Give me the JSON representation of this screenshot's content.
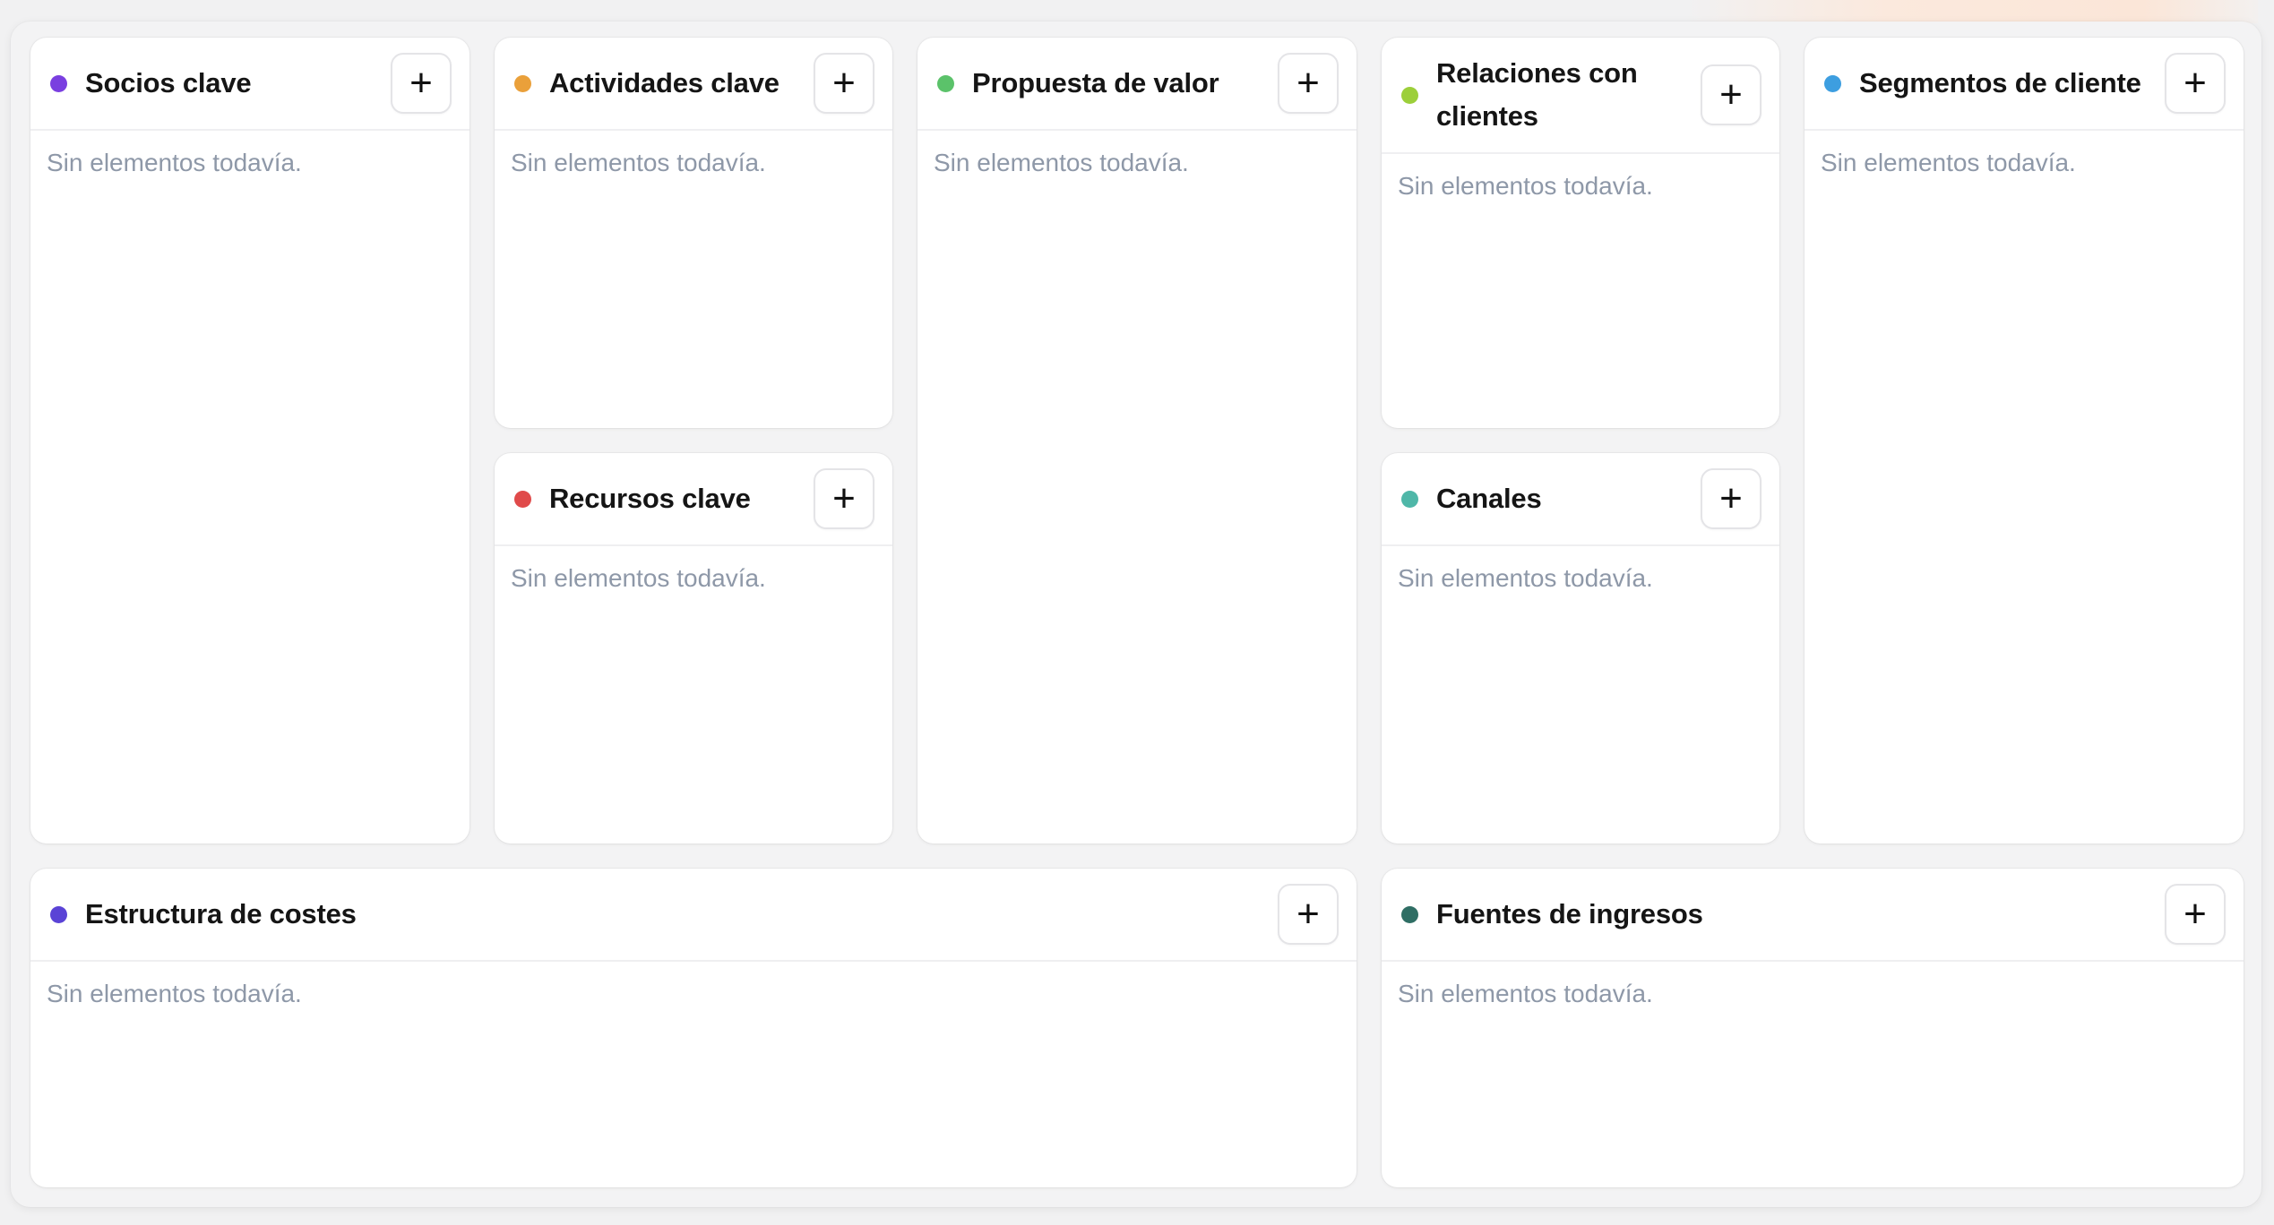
{
  "canvas": {
    "blocks": {
      "socios_clave": {
        "title": "Socios clave",
        "add_label": "+",
        "empty": "Sin elementos todavía.",
        "color": "#7a3fe0"
      },
      "actividades_clave": {
        "title": "Actividades clave",
        "add_label": "+",
        "empty": "Sin elementos todavía.",
        "color": "#eaa03a"
      },
      "recursos_clave": {
        "title": "Recursos clave",
        "add_label": "+",
        "empty": "Sin elementos todavía.",
        "color": "#e04a4a"
      },
      "propuesta_de_valor": {
        "title": "Propuesta de valor",
        "add_label": "+",
        "empty": "Sin elementos todavía.",
        "color": "#5bc26a"
      },
      "relaciones_con_clientes": {
        "title": "Relaciones con clientes",
        "add_label": "+",
        "empty": "Sin elementos todavía.",
        "color": "#9ccf3a"
      },
      "canales": {
        "title": "Canales",
        "add_label": "+",
        "empty": "Sin elementos todavía.",
        "color": "#4fb7a8"
      },
      "segmentos_de_cliente": {
        "title": "Segmentos de cliente",
        "add_label": "+",
        "empty": "Sin elementos todavía.",
        "color": "#3d9ee0"
      },
      "estructura_de_costes": {
        "title": "Estructura de costes",
        "add_label": "+",
        "empty": "Sin elementos todavía.",
        "color": "#5a43d6"
      },
      "fuentes_de_ingresos": {
        "title": "Fuentes de ingresos",
        "add_label": "+",
        "empty": "Sin elementos todavía.",
        "color": "#2f6e64"
      }
    }
  }
}
